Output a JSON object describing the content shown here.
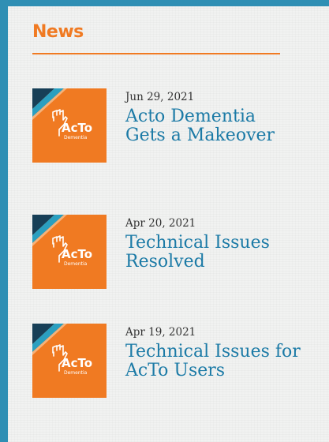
{
  "news": {
    "heading": "News",
    "thumbnail_logo": {
      "primary": "AcTo",
      "secondary": "Dementia"
    },
    "items": [
      {
        "date": "Jun 29, 2021",
        "title": "Acto Dementia Gets a Makeover"
      },
      {
        "date": "Apr 20, 2021",
        "title": "Technical Issues Resolved"
      },
      {
        "date": "Apr 19, 2021",
        "title": "Technical Issues for AcTo Users"
      }
    ]
  },
  "colors": {
    "frame": "#2f8fb4",
    "accent_orange": "#f07a22",
    "link_blue": "#1b7aa6",
    "stripe_dark": "#173f57",
    "stripe_teal": "#2a9fc0"
  },
  "icons": [
    "acto-dementia-logo-icon"
  ]
}
